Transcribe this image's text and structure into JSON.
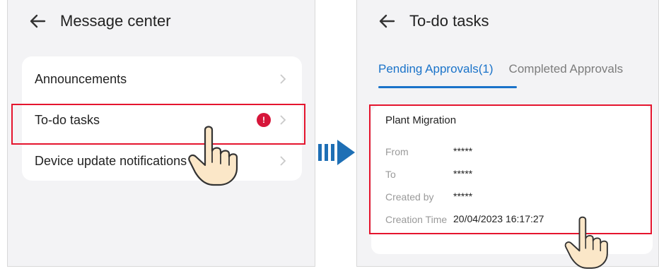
{
  "left_screen": {
    "title": "Message center",
    "items": [
      {
        "label": "Announcements"
      },
      {
        "label": "To-do tasks",
        "badge": "!"
      },
      {
        "label": "Device update notifications"
      }
    ]
  },
  "right_screen": {
    "title": "To-do tasks",
    "tabs": [
      {
        "label": "Pending Approvals(1)",
        "active": true
      },
      {
        "label": "Completed Approvals",
        "active": false
      }
    ],
    "task": {
      "title": "Plant Migration",
      "fields": [
        {
          "label": "From",
          "value": "*****"
        },
        {
          "label": "To",
          "value": "*****"
        },
        {
          "label": "Created by",
          "value": "*****"
        },
        {
          "label": "Creation Time",
          "value": "20/04/2023 16:17:27"
        }
      ]
    }
  },
  "colors": {
    "accent": "#1a73c9",
    "highlight": "#e5152e",
    "badge": "#d6163a"
  }
}
